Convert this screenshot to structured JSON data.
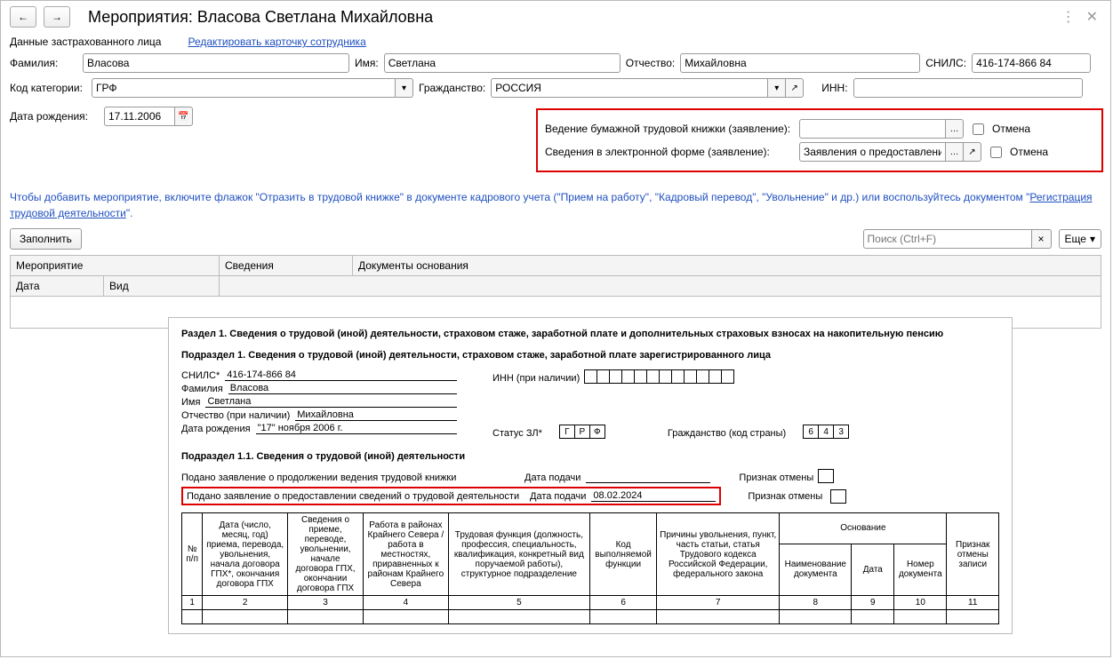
{
  "titlebar": {
    "title": "Мероприятия: Власова Светлана Михайловна"
  },
  "section_label": "Данные застрахованного лица",
  "edit_link": "Редактировать карточку сотрудника",
  "labels": {
    "surname": "Фамилия:",
    "name": "Имя:",
    "patronymic": "Отчество:",
    "snils": "СНИЛС:",
    "category": "Код категории:",
    "citizenship": "Гражданство:",
    "inn": "ИНН:",
    "birthdate": "Дата рождения:"
  },
  "fields": {
    "surname": "Власова",
    "name": "Светлана",
    "patronymic": "Михайловна",
    "snils": "416-174-866 84",
    "category": "ГРФ",
    "citizenship": "РОССИЯ",
    "inn": "",
    "birthdate": "17.11.2006"
  },
  "red_box": {
    "row1_label": "Ведение бумажной трудовой книжки (заявление):",
    "row1_value": "",
    "row2_label": "Сведения в электронной форме (заявление):",
    "row2_value": "Заявления о предоставлении сведен",
    "cancel_label": "Отмена"
  },
  "info": {
    "text1": "Чтобы добавить мероприятие, включите флажок \"Отразить в трудовой книжке\" в документе кадрового учета (\"Прием на работу\", \"Кадровый перевод\", \"Увольнение\" и др.) или воспользуйтесь документом \"",
    "link": "Регистрация трудовой деятельности",
    "text2": "\"."
  },
  "toolbar": {
    "fill": "Заполнить",
    "search_ph": "Поиск (Ctrl+F)",
    "more": "Еще"
  },
  "grid": {
    "col_event": "Мероприятие",
    "col_info": "Сведения",
    "col_docs": "Документы основания",
    "col_date": "Дата",
    "col_type": "Вид"
  },
  "pf": {
    "section_title": "Раздел 1. Сведения о трудовой (иной) деятельности, страховом стаже, заработной плате и дополнительных страховых взносах на накопительную пенсию",
    "subsection1": "Подраздел 1. Сведения о трудовой (иной) деятельности, страховом стаже, заработной плате зарегистрированного лица",
    "snils_label": "СНИЛС*",
    "snils_value": "416-174-866 84",
    "inn_label": "ИНН (при наличии)",
    "surname_label": "Фамилия",
    "surname_value": "Власова",
    "name_label": "Имя",
    "name_value": "Светлана",
    "patronymic_label": "Отчество (при наличии)",
    "patronymic_value": "Михайловна",
    "birthdate_label": "Дата рождения",
    "birthdate_value": "\"17\" ноября 2006 г.",
    "status_label": "Статус ЗЛ*",
    "status_g": "Г",
    "status_r": "Р",
    "status_f": "Ф",
    "citizenship_label": "Гражданство (код страны)",
    "citizenship_c1": "6",
    "citizenship_c2": "4",
    "citizenship_c3": "3",
    "subsection11": "Подраздел 1.1. Сведения о трудовой (иной) деятельности",
    "paper_stmt": "Подано заявление о продолжении ведения трудовой книжки",
    "elec_stmt": "Подано заявление о предоставлении сведений о трудовой деятельности",
    "date_label": "Дата подачи",
    "elec_date": "08.02.2024",
    "cancellation_label": "Признак отмены",
    "table": {
      "h1": "№ п/п",
      "h2": "Дата (число, месяц, год) приема, перевода, увольнения, начала договора ГПХ*, окончания договора ГПХ",
      "h3": "Сведения о приеме, переводе, увольнении, начале договора ГПХ, окончании договора ГПХ",
      "h4": "Работа в районах Крайнего Севера / работа в местностях, приравненных к районам Крайнего Севера",
      "h5": "Трудовая функция (должность, профессия, специальность, квалификация, конкретный вид поручаемой работы), структурное подразделение",
      "h6": "Код выполняемой функции",
      "h7": "Причины увольнения, пункт, часть статьи, статья Трудового кодекса Российской Федерации, федерального закона",
      "h8_group": "Основание",
      "h8": "Наименование документа",
      "h9": "Дата",
      "h10": "Номер документа",
      "h11": "Признак отмены записи",
      "n1": "1",
      "n2": "2",
      "n3": "3",
      "n4": "4",
      "n5": "5",
      "n6": "6",
      "n7": "7",
      "n8": "8",
      "n9": "9",
      "n10": "10",
      "n11": "11"
    }
  }
}
